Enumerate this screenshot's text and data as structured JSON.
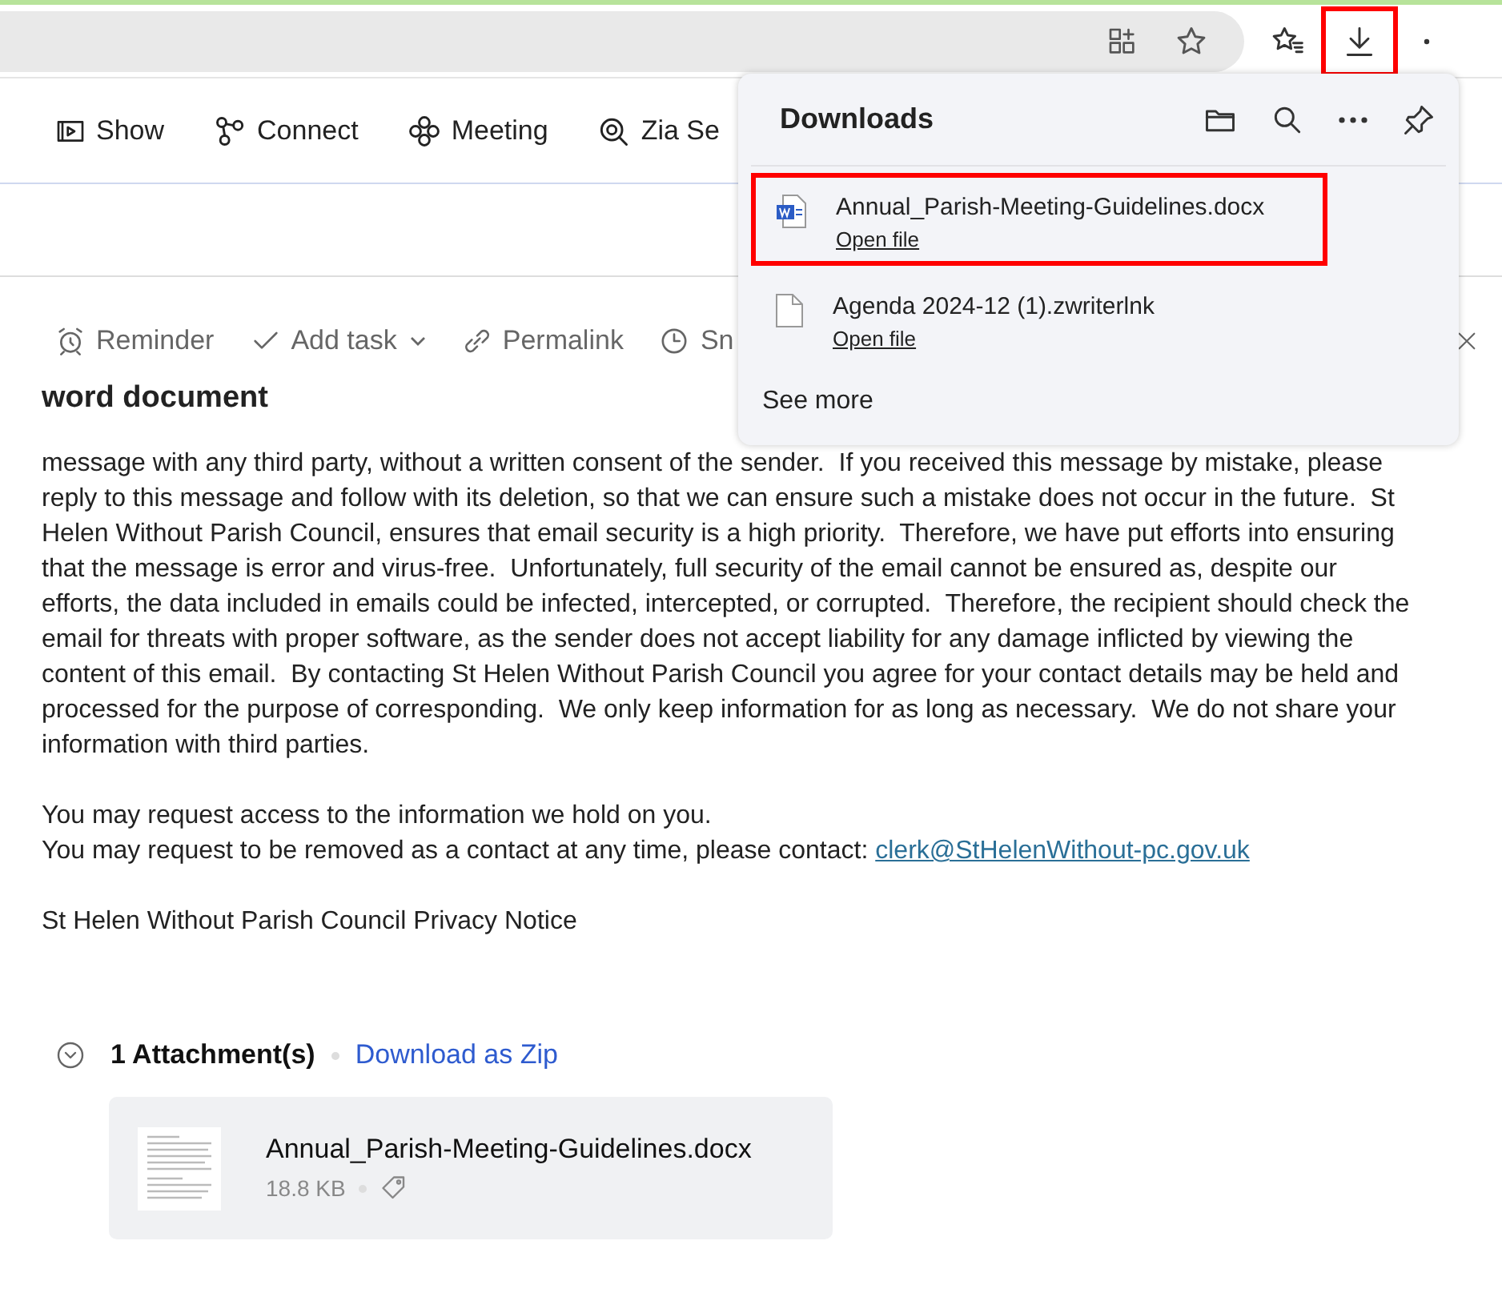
{
  "browser": {
    "download_button": {
      "highlighted": true
    }
  },
  "nav": [
    {
      "label": "Show"
    },
    {
      "label": "Connect"
    },
    {
      "label": "Meeting"
    },
    {
      "label": "Zia Se"
    }
  ],
  "actions": [
    {
      "label": "Reminder"
    },
    {
      "label": "Add task",
      "has_menu": true
    },
    {
      "label": "Permalink"
    },
    {
      "label": "Sn"
    }
  ],
  "message": {
    "subject": "word document",
    "paragraphs": [
      "message with any third party, without a written consent of the sender.  If you received this message by mistake, please reply to this message and follow with its deletion, so that we can ensure such a mistake does not occur in the future.  St Helen Without Parish Council, ensures that email security is a high priority.  Therefore, we have put efforts into ensuring that the message is error and virus-free.  Unfortunately, full security of the email cannot be ensured as, despite our efforts, the data included in emails could be infected, intercepted, or corrupted.  Therefore, the recipient should check the email for threats with proper software, as the sender does not accept liability for any damage inflicted by viewing the content of this email.  By contacting St Helen Without Parish Council you agree for your contact details may be held and processed for the purpose of corresponding.  We only keep information for as long as necessary.  We do not share your information with third parties."
    ],
    "access_line": "You may request access to the information we hold on you.",
    "contact_line": "You may request to be removed as a contact at any time, please contact:",
    "contact_email": "clerk@StHelenWithout-pc.gov.uk",
    "privacy_notice": "St Helen Without Parish Council Privacy Notice"
  },
  "attachments": {
    "count": "1 Attachment(s)",
    "download_all": "Download as Zip",
    "files": [
      {
        "name": "Annual_Parish-Meeting-Guidelines.docx",
        "size": "18.8 KB"
      }
    ]
  },
  "downloads_panel": {
    "title": "Downloads",
    "items": [
      {
        "kind": "word",
        "name": "Annual_Parish-Meeting-Guidelines.docx",
        "action": "Open file",
        "highlighted": true
      },
      {
        "kind": "generic",
        "name": "Agenda 2024-12 (1).zwriterlnk",
        "action": "Open file",
        "highlighted": false
      }
    ],
    "see_more": "See more"
  }
}
